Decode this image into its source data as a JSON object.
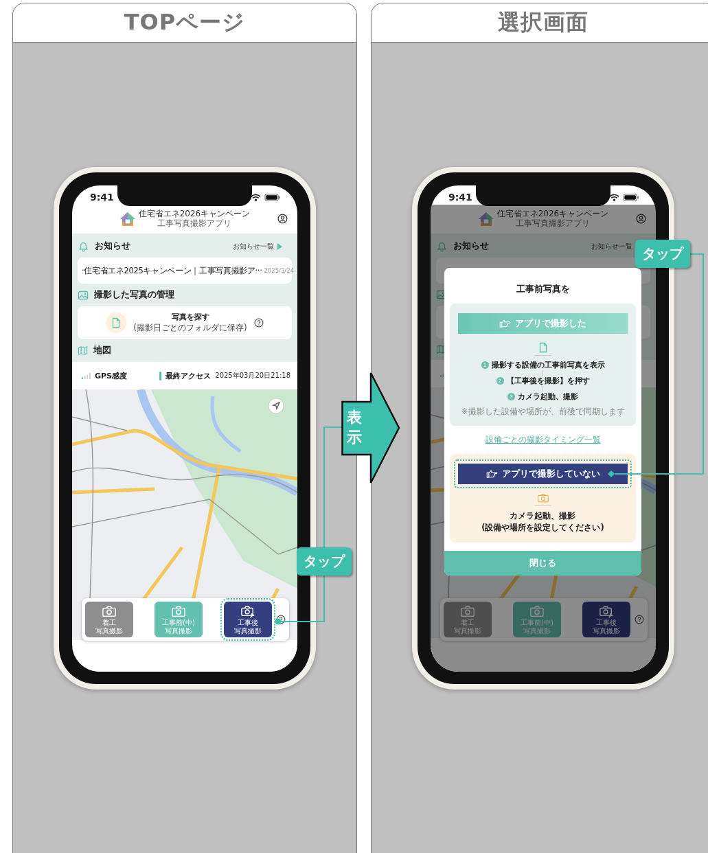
{
  "panels": [
    {
      "title": "TOPページ",
      "screen": {
        "time": "9:41",
        "logo_title": "住宅省エネ2026キャンペーン",
        "logo_subtitle": "工事写真撮影アプリ",
        "dimmed": false,
        "notices": {
          "heading": "お知らせ",
          "link": "お知らせ一覧",
          "items": [
            {
              "text": "·住宅省エネ2025キャンペーン｜工事写真撮影ア···",
              "date": "2025/3/24"
            }
          ]
        },
        "photos": {
          "heading": "撮影した写真の管理",
          "card_title": "写真を探す",
          "card_subtitle": "(撮影日ごとのフォルダに保存)"
        },
        "map": {
          "heading": "地図",
          "gps_label": "GPS感度",
          "last_access_label": "最終アクセス",
          "last_access": "2025年03月20日21:18"
        },
        "nav": [
          {
            "kind": "start",
            "lines": [
              "着工",
              "写真撮影"
            ],
            "highlighted": false
          },
          {
            "kind": "before",
            "lines": [
              "工事前(中)",
              "写真撮影"
            ],
            "highlighted": false
          },
          {
            "kind": "after",
            "lines": [
              "工事後",
              "写真撮影"
            ],
            "highlighted": true
          }
        ]
      },
      "callout": {
        "label": "タップ"
      }
    },
    {
      "title": "選択画面",
      "screen": {
        "time": "9:41",
        "logo_title": "住宅省エネ2026キャンペーン",
        "logo_subtitle": "工事写真撮影アプリ",
        "dimmed": true,
        "notices": {
          "heading": "お知らせ",
          "link": "お知らせ一覧"
        },
        "nav": [
          {
            "kind": "start",
            "lines": [
              "着工",
              "写真撮影"
            ],
            "highlighted": false
          },
          {
            "kind": "before",
            "lines": [
              "工事前(中)",
              "写真撮影"
            ],
            "highlighted": false
          },
          {
            "kind": "after",
            "lines": [
              "工事後",
              "写真撮影"
            ],
            "highlighted": false
          }
        ]
      },
      "modal": {
        "title": "工事前写真を",
        "options": [
          {
            "kind": "synced",
            "button": "アプリで撮影した",
            "highlighted": false,
            "steps": [
              {
                "number": "1",
                "text": "撮影する設備の工事前写真を表示"
              },
              {
                "number": "2",
                "text": "【工事後を撮影】を押す"
              },
              {
                "number": "3",
                "text": "カメラ起動、撮影"
              }
            ],
            "note": "※撮影した設備や場所が、前後で同期します"
          },
          {
            "kind": "manual",
            "button": "アプリで撮影していない",
            "highlighted": true,
            "lines": [
              "カメラ起動、撮影",
              "(設備や場所を設定してください)"
            ]
          }
        ],
        "link": "設備ごとの撮影タイミング一覧",
        "close": "閉じる"
      },
      "callout": {
        "label": "タップ"
      }
    }
  ],
  "transition": {
    "label": "表示"
  }
}
